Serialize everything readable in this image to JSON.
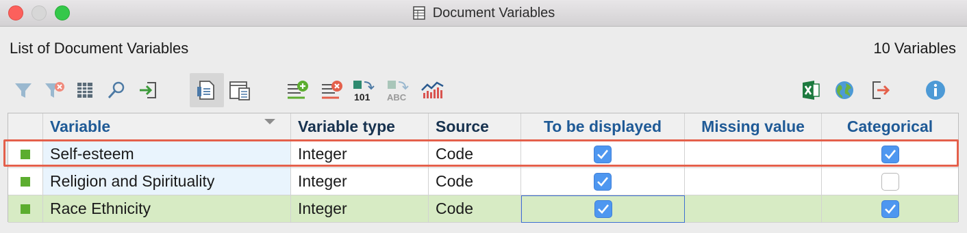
{
  "window": {
    "title": "Document Variables",
    "icon": "table-document-icon"
  },
  "header": {
    "list_title": "List of Document Variables",
    "count": "10 Variables"
  },
  "toolbar": {
    "left_icons": [
      "filter-icon",
      "clear-filter-icon",
      "columns-icon",
      "search-icon",
      "import-icon"
    ],
    "view_icons": [
      "document-variables-view-icon",
      "code-variables-view-icon"
    ],
    "edit_icons": [
      "add-variable-icon",
      "delete-variable-icon",
      "convert-to-number-icon",
      "convert-to-text-icon",
      "statistics-icon"
    ],
    "right_icons": [
      "excel-export-icon",
      "web-export-icon",
      "export-icon",
      "info-icon"
    ]
  },
  "table": {
    "columns": [
      "Variable",
      "Variable type",
      "Source",
      "To be displayed",
      "Missing value",
      "Categorical"
    ],
    "rows": [
      {
        "variable": "Self-esteem",
        "type": "Integer",
        "source": "Code",
        "displayed": true,
        "missing": "",
        "categorical": true
      },
      {
        "variable": "Religion and Spirituality",
        "type": "Integer",
        "source": "Code",
        "displayed": true,
        "missing": "",
        "categorical": false
      },
      {
        "variable": "Race Ethnicity",
        "type": "Integer",
        "source": "Code",
        "displayed": true,
        "missing": "",
        "categorical": true
      }
    ]
  },
  "colors": {
    "highlight_outline": "#e4604b",
    "row_selected": "#d7ebc4",
    "checkbox": "#4e97f0",
    "header_text": "#1f5a96"
  }
}
